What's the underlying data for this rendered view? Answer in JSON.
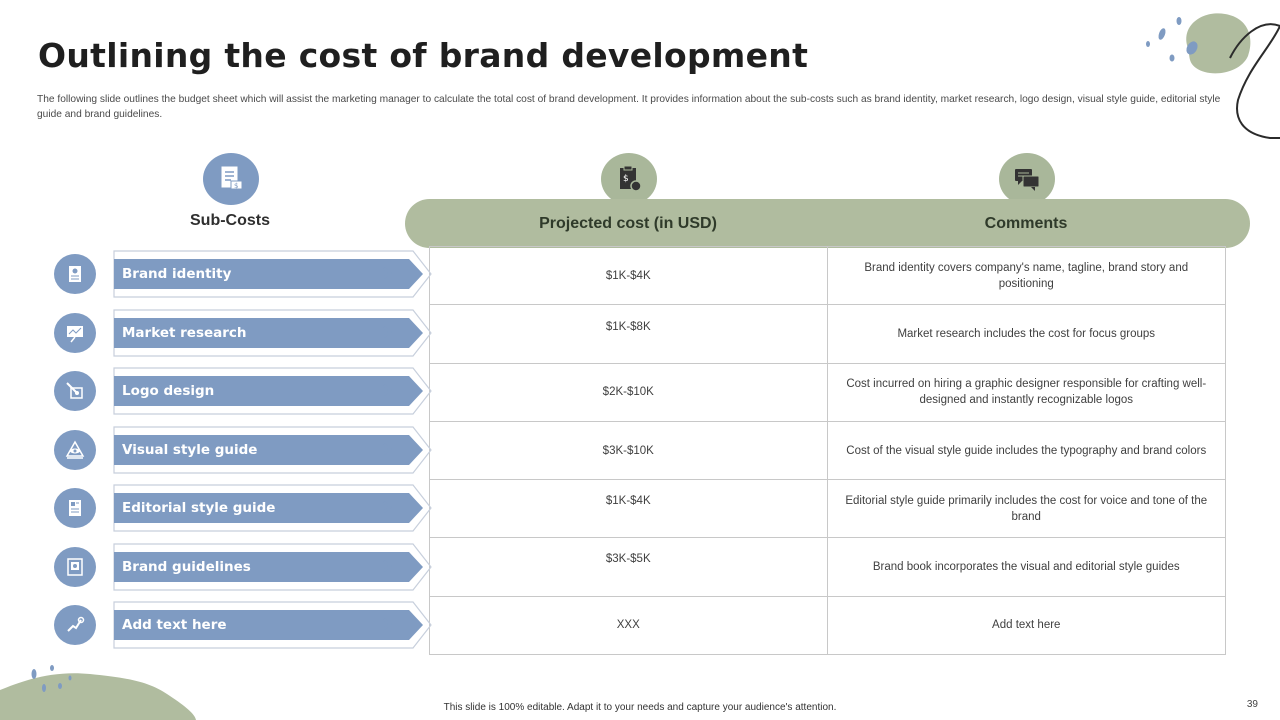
{
  "slide": {
    "title": "Outlining the cost of brand development",
    "subtitle": "The following slide outlines the budget sheet which will assist the marketing manager to calculate the total cost of brand development. It provides information about the sub-costs such as brand identity, market research, logo design, visual style guide, editorial style guide and brand guidelines.",
    "footer": "This slide is 100% editable. Adapt it to your needs and capture your audience's attention.",
    "page_number": "39"
  },
  "colors": {
    "accent_blue": "#7f9bc2",
    "accent_green": "#b0bc9f"
  },
  "subcosts": {
    "heading": "Sub-Costs",
    "items": [
      {
        "label": "Brand identity",
        "icon": "id-card-icon"
      },
      {
        "label": "Market research",
        "icon": "presentation-board-icon"
      },
      {
        "label": "Logo design",
        "icon": "design-tool-icon"
      },
      {
        "label": "Visual style guide",
        "icon": "eye-pyramid-icon"
      },
      {
        "label": "Editorial style guide",
        "icon": "document-layout-icon"
      },
      {
        "label": "Brand guidelines",
        "icon": "brand-book-icon"
      },
      {
        "label": "Add text here",
        "icon": "growth-arrow-icon"
      }
    ]
  },
  "table": {
    "headers": [
      "Projected cost (in USD)",
      "Comments"
    ],
    "rows": [
      {
        "cost": "$1K-$4K",
        "comment": "Brand identity covers company's name, tagline, brand story and positioning"
      },
      {
        "cost": "$1K-$8K",
        "comment": "Market research includes the cost for focus groups"
      },
      {
        "cost": "$2K-$10K",
        "comment": "Cost incurred on hiring a graphic designer responsible for crafting well-designed and instantly recognizable logos"
      },
      {
        "cost": "$3K-$10K",
        "comment": "Cost of the visual style guide includes the typography and brand colors"
      },
      {
        "cost": "$1K-$4K",
        "comment": "Editorial style guide primarily includes the cost for voice and tone of the brand"
      },
      {
        "cost": "$3K-$5K",
        "comment": "Brand book incorporates the visual and editorial style guides"
      },
      {
        "cost": "XXX",
        "comment": "Add text here"
      }
    ]
  }
}
